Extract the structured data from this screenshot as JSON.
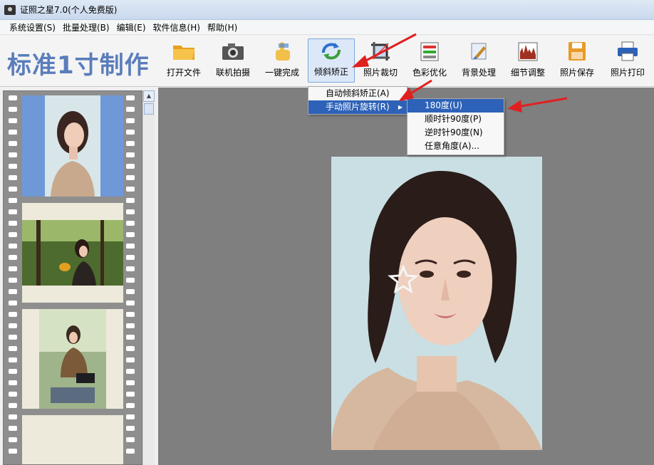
{
  "window": {
    "title": "证照之星7.0(个人免费版)"
  },
  "menubar": [
    "系统设置(S)",
    "批量处理(B)",
    "编辑(E)",
    "软件信息(H)",
    "帮助(H)"
  ],
  "brand": "标准1寸制作",
  "toolbar": {
    "tools": [
      {
        "label": "打开文件",
        "icon": "folder-icon"
      },
      {
        "label": "联机拍摄",
        "icon": "camera-icon"
      },
      {
        "label": "一键完成",
        "icon": "hand-pointer-icon"
      },
      {
        "label": "倾斜矫正",
        "icon": "rotate-icon"
      },
      {
        "label": "照片裁切",
        "icon": "crop-icon"
      },
      {
        "label": "色彩优化",
        "icon": "color-sliders-icon"
      },
      {
        "label": "背景处理",
        "icon": "brush-icon"
      },
      {
        "label": "细节调整",
        "icon": "histogram-icon"
      },
      {
        "label": "照片保存",
        "icon": "floppy-disk-icon"
      },
      {
        "label": "照片打印",
        "icon": "printer-icon"
      }
    ],
    "active": "倾斜矫正"
  },
  "menus": {
    "tilt": [
      "自动倾斜矫正(A)",
      "手动照片旋转(R)"
    ],
    "rotate": [
      "180度(U)",
      "顺时针90度(P)",
      "逆时针90度(N)",
      "任意角度(A)..."
    ]
  },
  "colors": {
    "accent": "#2e62b8",
    "brand": "#5a7dbb",
    "arrow": "#e02020"
  }
}
